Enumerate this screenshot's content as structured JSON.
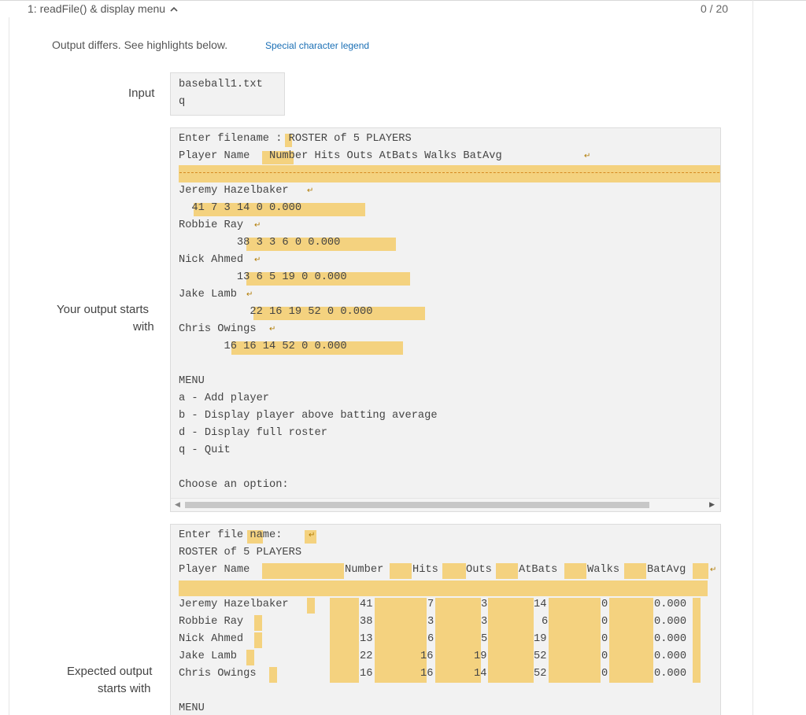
{
  "header": {
    "title": "1: readFile() & display menu",
    "chevron": "^",
    "score": "0 / 20"
  },
  "diff": {
    "message": "Output differs. See highlights below.",
    "legend_link": "Special character legend"
  },
  "labels": {
    "input": "Input",
    "your_output_1": "Your output starts",
    "your_output_2": "with",
    "expected_1": "Expected output",
    "expected_2": "starts with"
  },
  "input_lines": [
    "baseball1.txt",
    "q"
  ],
  "your_output": {
    "lines": [
      "Enter filename : ROSTER of 5 PLAYERS",
      "Player Name   Number Hits Outs AtBats Walks BatAvg",
      "",
      "Jeremy Hazelbaker",
      "  41 7 3 14 0 0.000",
      "Robbie Ray",
      "         38 3 3 6 0 0.000",
      "Nick Ahmed",
      "         13 6 5 19 0 0.000",
      "Jake Lamb",
      "           22 16 19 52 0 0.000",
      "Chris Owings",
      "       16 16 14 52 0 0.000",
      "",
      "MENU",
      "a - Add player",
      "b - Display player above batting average",
      "d - Display full roster",
      "q - Quit",
      "",
      "Choose an option:"
    ]
  },
  "expected_output": {
    "line1": "Enter file name: ",
    "line2": "ROSTER of 5 PLAYERS",
    "headers": [
      "Player Name",
      "Number",
      "Hits",
      "Outs",
      "AtBats",
      "Walks",
      "BatAvg"
    ],
    "rows": [
      [
        "Jeremy Hazelbaker",
        "41",
        "7",
        "3",
        "14",
        "0",
        "0.000"
      ],
      [
        "Robbie Ray",
        "38",
        "3",
        "3",
        "6",
        "0",
        "0.000"
      ],
      [
        "Nick Ahmed",
        "13",
        "6",
        "5",
        "19",
        "0",
        "0.000"
      ],
      [
        "Jake Lamb",
        "22",
        "16",
        "19",
        "52",
        "0",
        "0.000"
      ],
      [
        "Chris Owings",
        "16",
        "16",
        "14",
        "52",
        "0",
        "0.000"
      ]
    ],
    "menu": "MENU"
  },
  "colors": {
    "highlight": "#f4d27f",
    "link": "#1a6fb5",
    "box_bg": "#f2f2f2"
  }
}
